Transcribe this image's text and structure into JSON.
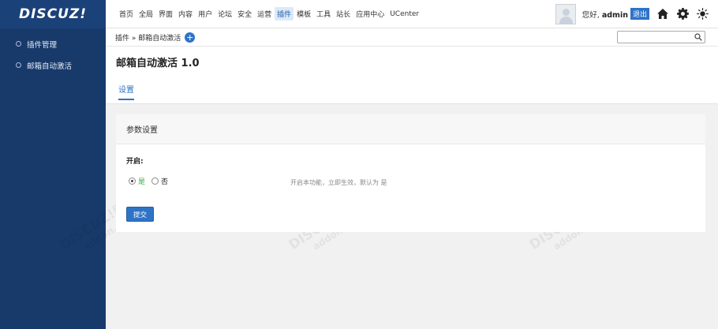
{
  "logo": "DISCUZ!",
  "sidebar": {
    "items": [
      {
        "label": "插件管理"
      },
      {
        "label": "邮箱自动激活"
      }
    ]
  },
  "topnav": {
    "items": [
      {
        "label": "首页"
      },
      {
        "label": "全局"
      },
      {
        "label": "界面"
      },
      {
        "label": "内容"
      },
      {
        "label": "用户"
      },
      {
        "label": "论坛"
      },
      {
        "label": "安全"
      },
      {
        "label": "运营"
      },
      {
        "label": "插件"
      },
      {
        "label": "模板"
      },
      {
        "label": "工具"
      },
      {
        "label": "站长"
      },
      {
        "label": "应用中心"
      },
      {
        "label": "UCenter"
      }
    ],
    "active_index": 8
  },
  "user": {
    "greeting": "您好,",
    "name": "admin",
    "logout_label": "退出"
  },
  "breadcrumb": {
    "text": "插件 » 邮箱自动激活"
  },
  "search": {
    "value": ""
  },
  "page": {
    "title": "邮箱自动激活 1.0",
    "tab_label": "设置"
  },
  "settings": {
    "section_title": "参数设置",
    "field_label": "开启:",
    "option_yes": "是",
    "option_no": "否",
    "selected": "是",
    "hint": "开启本功能，立即生效，默认为 是",
    "submit_label": "提交"
  },
  "watermark": {
    "line1": "DISCUZ!应用中心 | 贰道",
    "line2": "addon.dismall.com"
  },
  "colors": {
    "sidebar_bg": "#183a6b",
    "accent": "#2e73c6",
    "yes_green": "#3aa640"
  }
}
